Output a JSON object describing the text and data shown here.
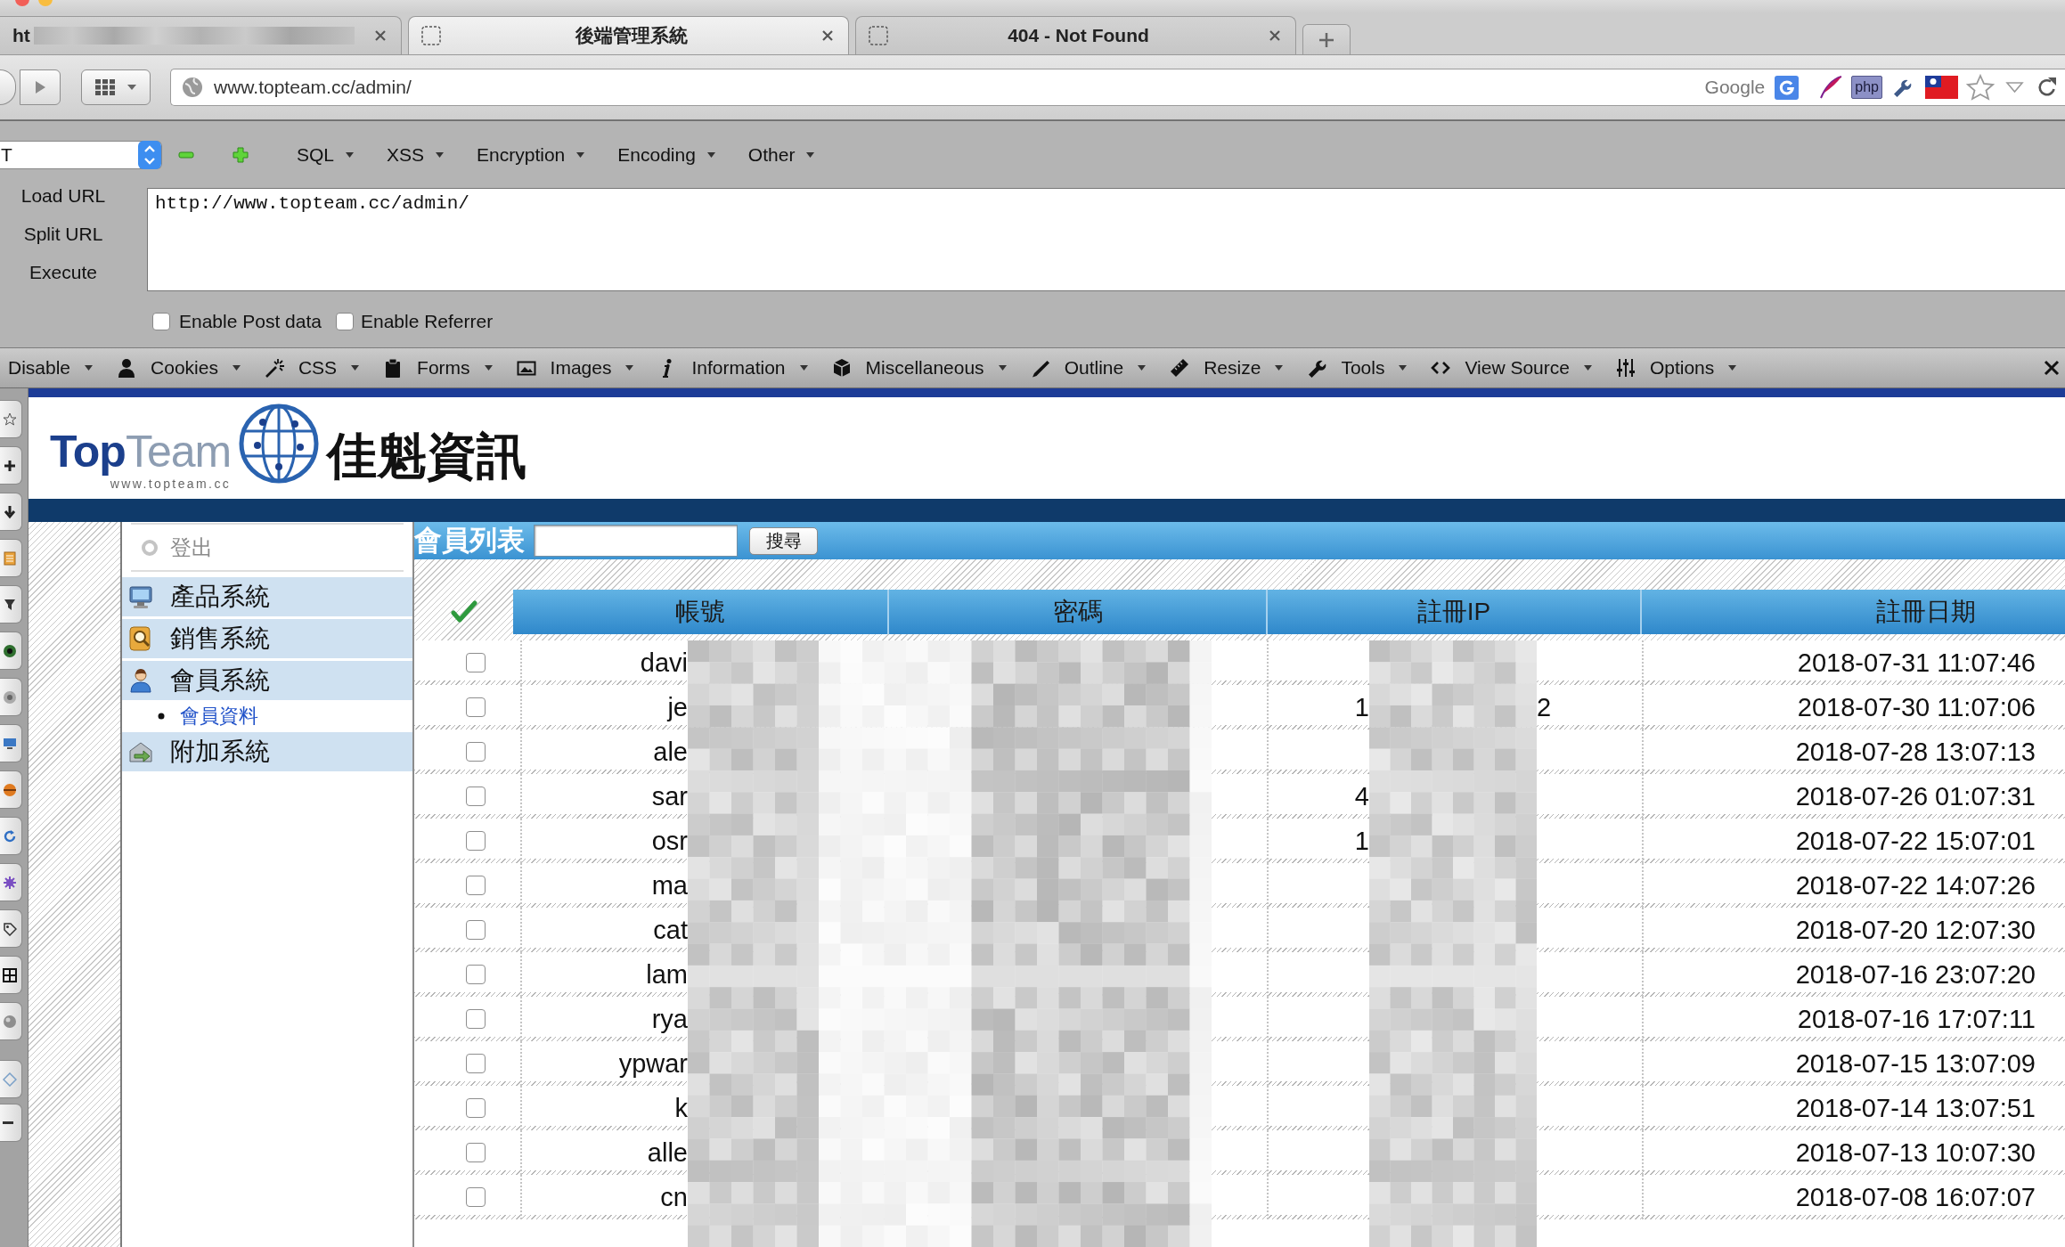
{
  "window": {
    "tabs": [
      {
        "title": "ht",
        "redacted": true,
        "selected": false
      },
      {
        "title": "後端管理系統",
        "redacted": false,
        "selected": true
      },
      {
        "title": "404 - Not Found",
        "redacted": false,
        "selected": false
      }
    ]
  },
  "address_bar": {
    "url": "www.topteam.cc/admin/",
    "search_engine": "Google",
    "extension_label": "php"
  },
  "hackbar": {
    "mode": "T",
    "menus": [
      "SQL",
      "XSS",
      "Encryption",
      "Encoding",
      "Other"
    ],
    "actions": [
      "Load URL",
      "Split URL",
      "Execute"
    ],
    "url": "http://www.topteam.cc/admin/",
    "options": [
      {
        "label": "Enable Post data",
        "checked": false
      },
      {
        "label": "Enable Referrer",
        "checked": false
      }
    ]
  },
  "developer_toolbar": {
    "menus": [
      "Disable",
      "Cookies",
      "CSS",
      "Forms",
      "Images",
      "Information",
      "Miscellaneous",
      "Outline",
      "Resize",
      "Tools",
      "View Source",
      "Options"
    ]
  },
  "site": {
    "logo": {
      "wordmark": "**Top**Team",
      "domain": "www.topteam.cc",
      "company": "佳魁資訊"
    },
    "sidebar": {
      "logout": "登出",
      "items": [
        {
          "label": "產品系統"
        },
        {
          "label": "銷售系統"
        },
        {
          "label": "會員系統",
          "children": [
            {
              "label": "會員資料"
            }
          ]
        },
        {
          "label": "附加系統"
        }
      ]
    },
    "member_list": {
      "title": "會員列表",
      "search_button": "搜尋",
      "columns": [
        "帳號",
        "密碼",
        "註冊IP",
        "註冊日期"
      ],
      "rows": [
        {
          "checked": false,
          "account": "davi",
          "date": "2018-07-31 11:07:46"
        },
        {
          "checked": false,
          "account": "je",
          "ip_start": "1",
          "ip_end": "2",
          "date": "2018-07-30 11:07:06"
        },
        {
          "checked": false,
          "account": "ale",
          "date": "2018-07-28 13:07:13"
        },
        {
          "checked": false,
          "account": "sar",
          "ip_start": "4",
          "date": "2018-07-26 01:07:31"
        },
        {
          "checked": false,
          "account": "osr",
          "ip_start": "1",
          "date": "2018-07-22 15:07:01"
        },
        {
          "checked": false,
          "account": "ma",
          "date": "2018-07-22 14:07:26"
        },
        {
          "checked": false,
          "account": "cat",
          "date": "2018-07-20 12:07:30"
        },
        {
          "checked": false,
          "account": "lam",
          "date": "2018-07-16 23:07:20"
        },
        {
          "checked": false,
          "account": "rya",
          "date": "2018-07-16 17:07:11"
        },
        {
          "checked": false,
          "account": "ypwar",
          "date": "2018-07-15 13:07:09"
        },
        {
          "checked": false,
          "account": "k",
          "date": "2018-07-14 13:07:51"
        },
        {
          "checked": false,
          "account": "alle",
          "date": "2018-07-13 10:07:30"
        },
        {
          "checked": false,
          "account": "cn",
          "date": "2018-07-08 16:07:07"
        }
      ]
    }
  }
}
